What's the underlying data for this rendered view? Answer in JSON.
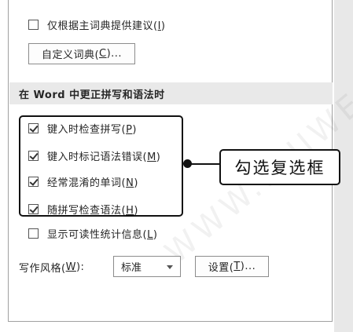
{
  "options_top": [
    {
      "label": "仅根据主词典提供建议(",
      "key": "I",
      "suffix": ")",
      "checked": false
    }
  ],
  "custom_dict_button": {
    "label": "自定义词典(",
    "key": "C",
    "suffix": ")..."
  },
  "section_title": "在 Word 中更正拼写和语法时",
  "grammar_options": [
    {
      "label": "键入时检查拼写(",
      "key": "P",
      "suffix": ")",
      "checked": true
    },
    {
      "label": "键入时标记语法错误(",
      "key": "M",
      "suffix": ")",
      "checked": true
    },
    {
      "label": "经常混淆的单词(",
      "key": "N",
      "suffix": ")",
      "checked": true
    },
    {
      "label": "随拼写检查语法(",
      "key": "H",
      "suffix": ")",
      "checked": true
    }
  ],
  "readability": {
    "label": "显示可读性统计信息(",
    "key": "L",
    "suffix": ")",
    "checked": false
  },
  "writing_style": {
    "label": "写作风格(",
    "key": "W",
    "suffix": "):",
    "value": "标准"
  },
  "settings_button": {
    "label": "设置(",
    "key": "T",
    "suffix": ")..."
  },
  "callout_text": "勾选复选框",
  "watermark_text": "WWW.RUIWEN.COM",
  "colors": {
    "section_bg": "#e9e9e9",
    "border": "#8c8c8c",
    "annotation": "#111111"
  }
}
